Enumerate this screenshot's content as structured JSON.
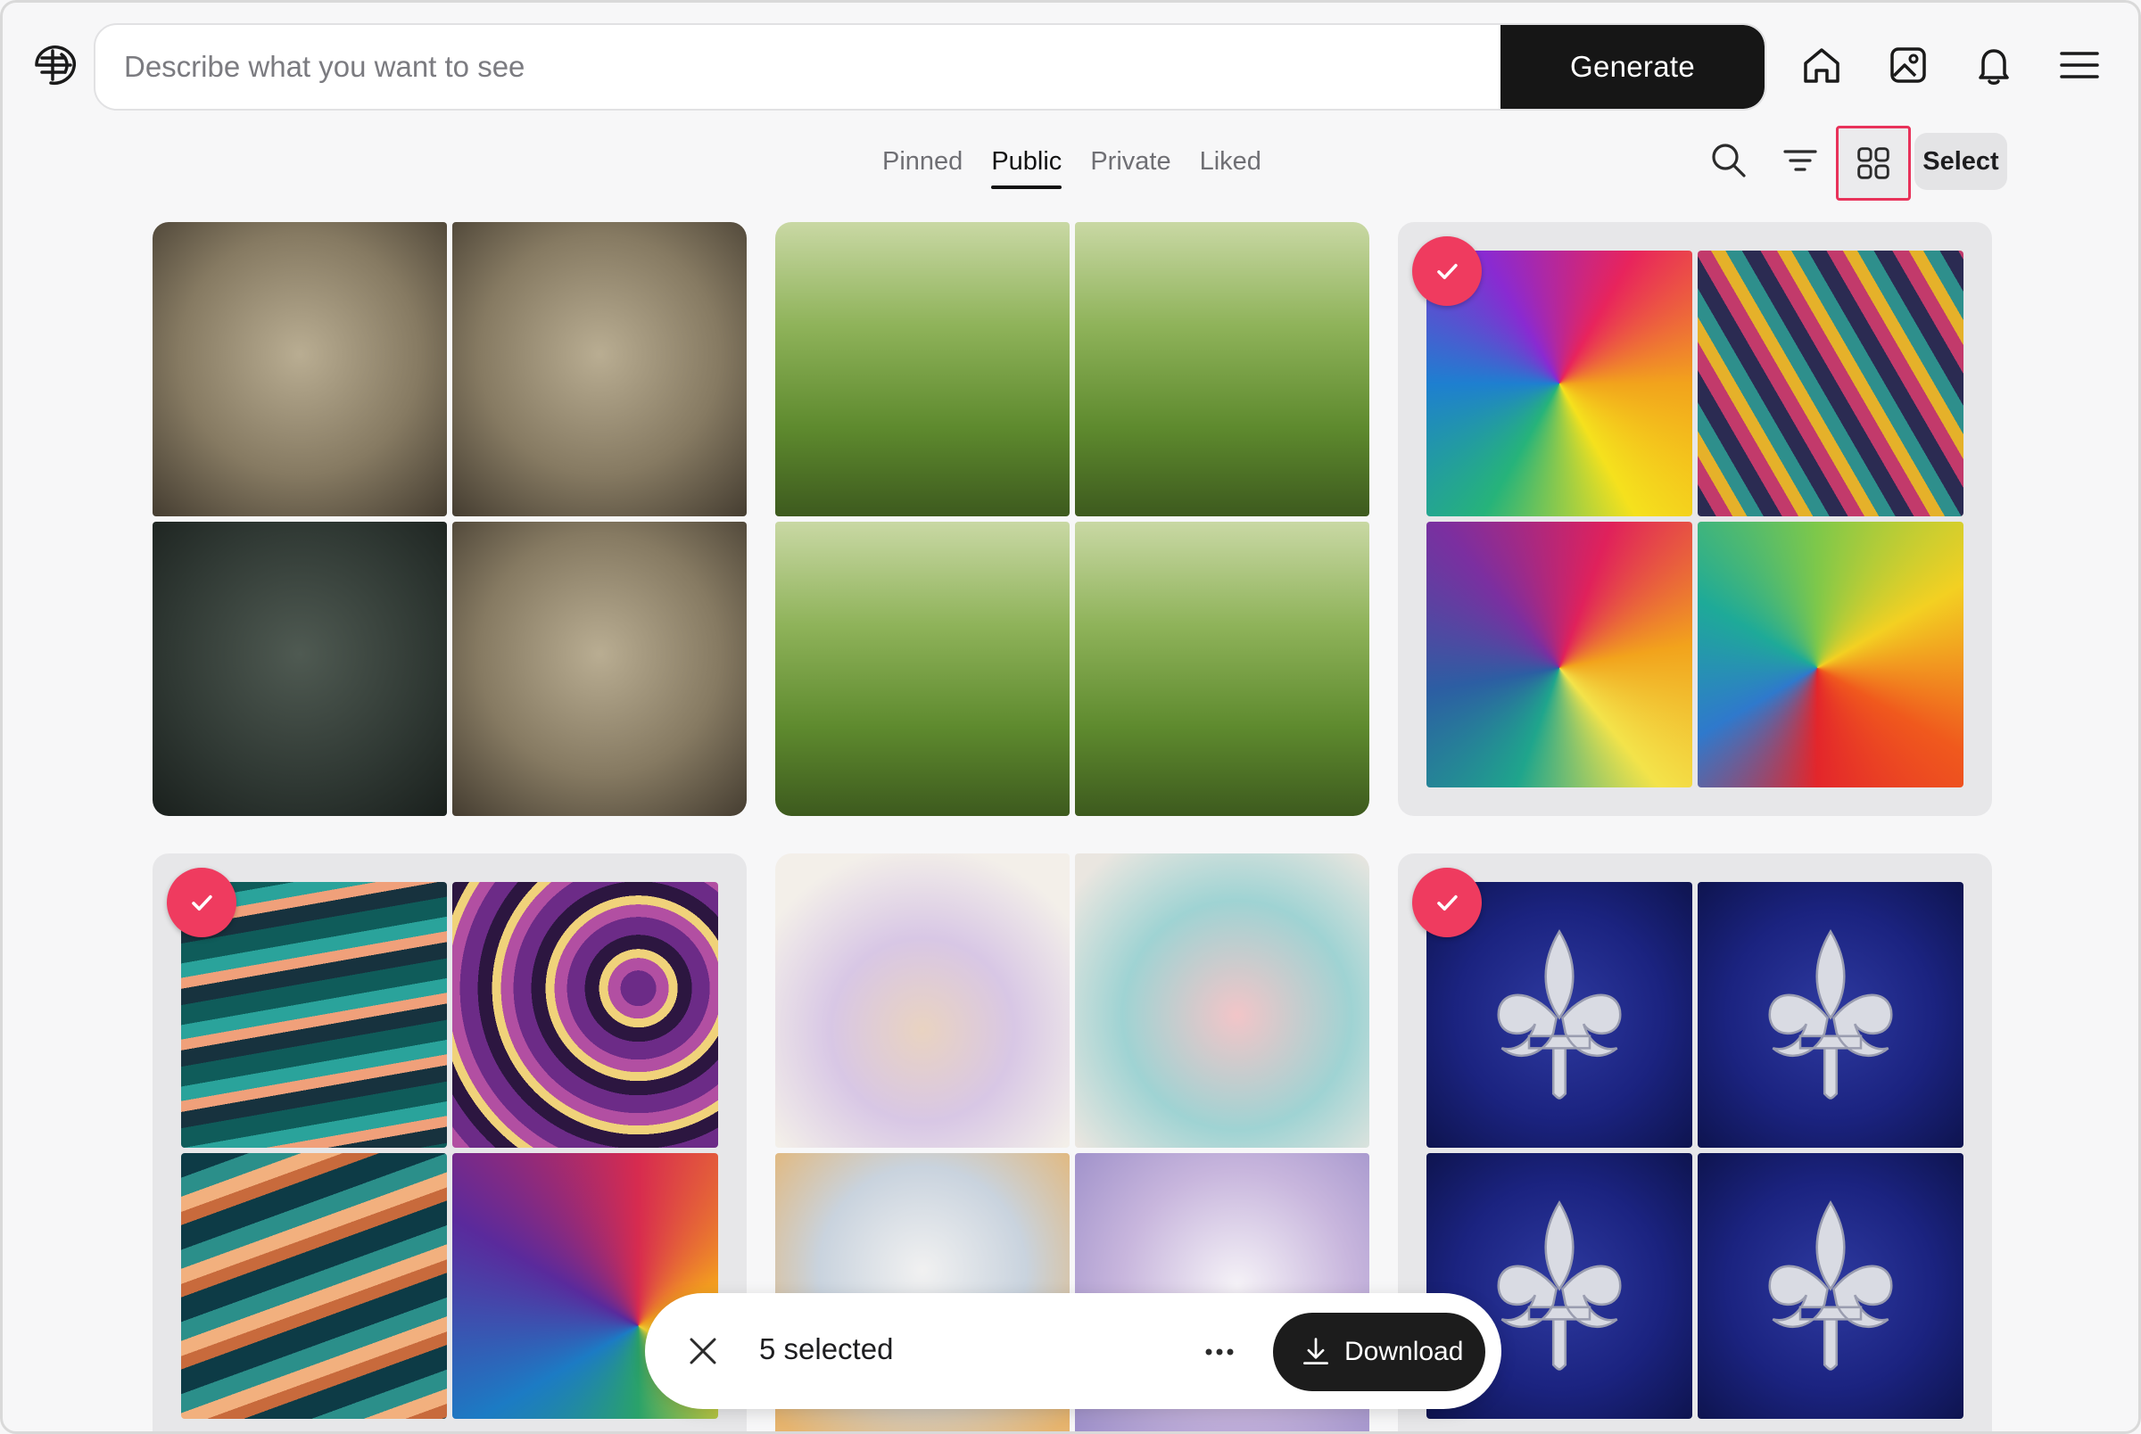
{
  "header": {
    "prompt_placeholder": "Describe what you want to see",
    "generate_label": "Generate",
    "icons": [
      "logo-icon",
      "home-icon",
      "gallery-icon",
      "bell-icon",
      "menu-icon"
    ]
  },
  "tabs": [
    {
      "label": "Pinned",
      "active": false
    },
    {
      "label": "Public",
      "active": true
    },
    {
      "label": "Private",
      "active": false
    },
    {
      "label": "Liked",
      "active": false
    }
  ],
  "toolbar": {
    "select_label": "Select",
    "icons": [
      "search-icon",
      "filter-icon",
      "grid-view-icon"
    ]
  },
  "cards": [
    {
      "name": "giraffe-card",
      "selected": false
    },
    {
      "name": "kitten-card",
      "selected": false
    },
    {
      "name": "polygon-card",
      "selected": true
    },
    {
      "name": "waves-card",
      "selected": true
    },
    {
      "name": "teacup-card",
      "selected": false
    },
    {
      "name": "fleur-de-lis-card",
      "selected": true
    }
  ],
  "selection_bar": {
    "count_label": "5 selected",
    "download_label": "Download"
  },
  "colors": {
    "accent": "#ef3b5f",
    "highlight_border": "#e8325a",
    "dark": "#161616",
    "background": "#f7f7f8"
  }
}
